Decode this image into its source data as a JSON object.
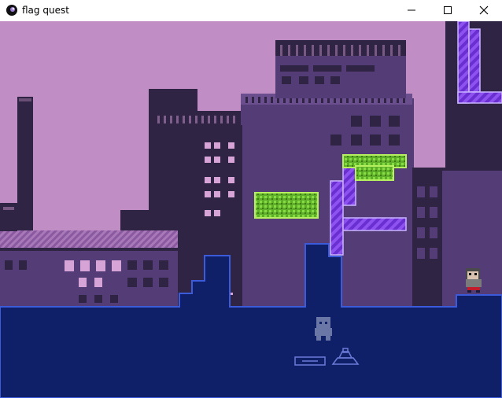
{
  "window": {
    "title": "flag quest",
    "icons": {
      "app": "flag-quest-app-icon",
      "minimize": "minimize-icon",
      "maximize": "maximize-icon",
      "close": "close-icon"
    }
  },
  "palette": {
    "sky": "#c08ec4",
    "building_light": "#543d76",
    "building_dark": "#2f2443",
    "window_lit": "#d6a4d6",
    "ground": "#0f2068",
    "ground_edge": "#3b5bdb",
    "platform_purple": "#7c3ae0",
    "foliage_green": "#7bd43a"
  },
  "game": {
    "player": "player-character",
    "ghost": "ghost-character",
    "spawn_marker": "spawn-pad-icon",
    "flag_marker": "flag-base-icon"
  }
}
